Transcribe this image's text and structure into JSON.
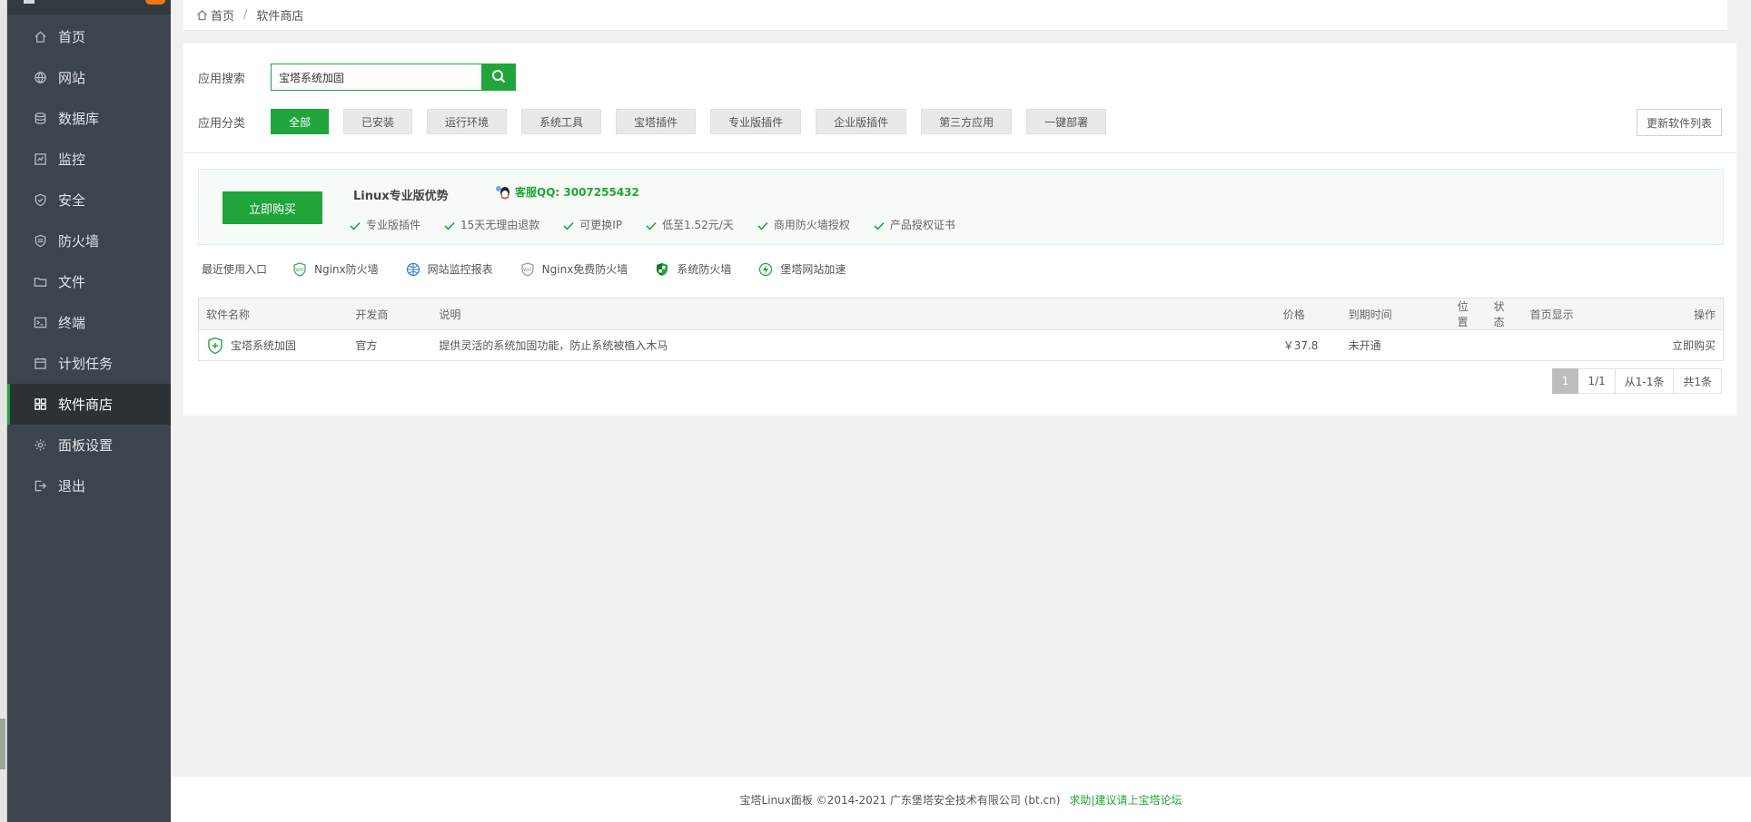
{
  "sidebar": {
    "items": [
      {
        "label": "首页",
        "icon": "home-icon"
      },
      {
        "label": "网站",
        "icon": "globe-icon"
      },
      {
        "label": "数据库",
        "icon": "database-icon"
      },
      {
        "label": "监控",
        "icon": "monitor-icon"
      },
      {
        "label": "安全",
        "icon": "shield-icon"
      },
      {
        "label": "防火墙",
        "icon": "firewall-icon"
      },
      {
        "label": "文件",
        "icon": "folder-icon"
      },
      {
        "label": "终端",
        "icon": "terminal-icon"
      },
      {
        "label": "计划任务",
        "icon": "calendar-icon"
      },
      {
        "label": "软件商店",
        "icon": "grid-icon",
        "active": true
      },
      {
        "label": "面板设置",
        "icon": "gear-icon"
      },
      {
        "label": "退出",
        "icon": "logout-icon"
      }
    ]
  },
  "breadcrumb": {
    "home": "首页",
    "current": "软件商店"
  },
  "search": {
    "label": "应用搜索",
    "value": "宝塔系统加固"
  },
  "categories": {
    "label": "应用分类",
    "items": [
      "全部",
      "已安装",
      "运行环境",
      "系统工具",
      "宝塔插件",
      "专业版插件",
      "企业版插件",
      "第三方应用",
      "一键部署"
    ],
    "active_index": 0
  },
  "refresh_label": "更新软件列表",
  "promo": {
    "buy_label": "立即购买",
    "title": "Linux专业版优势",
    "qq": "客服QQ: 3007255432",
    "advantages": [
      "专业版插件",
      "15天无理由退款",
      "可更换IP",
      "低至1.52元/天",
      "商用防火墙授权",
      "产品授权证书"
    ]
  },
  "recent": {
    "label": "最近使用入口",
    "items": [
      {
        "label": "Nginx防火墙",
        "icon": "waf-icon"
      },
      {
        "label": "网站监控报表",
        "icon": "globe-report-icon"
      },
      {
        "label": "Nginx免费防火墙",
        "icon": "waf-free-icon"
      },
      {
        "label": "系统防火墙",
        "icon": "shield-green-icon"
      },
      {
        "label": "堡塔网站加速",
        "icon": "bolt-icon"
      }
    ]
  },
  "table": {
    "headers": {
      "name": "软件名称",
      "dev": "开发商",
      "desc": "说明",
      "price": "价格",
      "expire": "到期时间",
      "pos": "位置",
      "status": "状态",
      "home": "首页显示",
      "op": "操作"
    },
    "rows": [
      {
        "name": "宝塔系统加固",
        "dev": "官方",
        "desc": "提供灵活的系统加固功能，防止系统被植入木马",
        "price": "￥37.8",
        "expire": "未开通",
        "op": "立即购买"
      }
    ]
  },
  "pager": {
    "current": "1",
    "pages": "1/1",
    "range": "从1-1条",
    "total": "共1条"
  },
  "footer": {
    "copyright": "宝塔Linux面板 ©2014-2021 广东堡塔安全技术有限公司 (bt.cn)",
    "link": "求助|建议请上宝塔论坛"
  },
  "colors": {
    "accent": "#20a53a",
    "price": "#f0780e",
    "sidebar": "#3c444d"
  }
}
